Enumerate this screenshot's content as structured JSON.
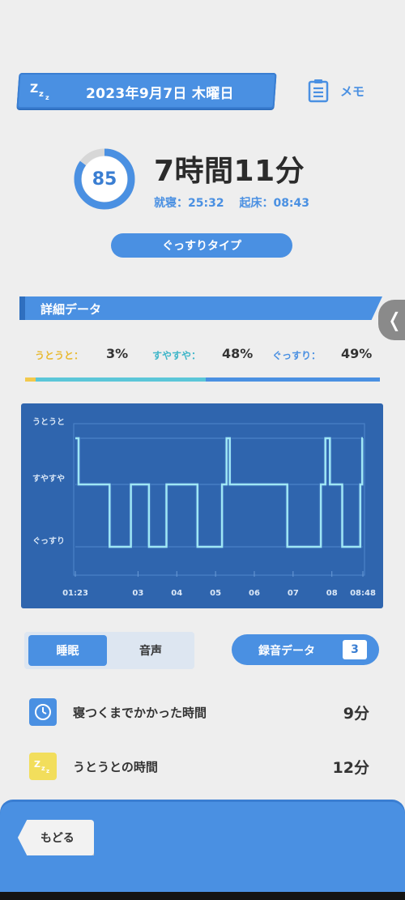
{
  "header": {
    "date": "2023年9月7日 木曜日",
    "memo_label": "メモ"
  },
  "summary": {
    "score": "85",
    "score_fraction": 0.85,
    "duration": "7時間11分",
    "bedtime": "就寝：25:32",
    "waketime": "起床：08:43",
    "type": "ぐっすりタイプ"
  },
  "details": {
    "title": "詳細データ",
    "stats": [
      {
        "label": "うとうと：",
        "value": "3%",
        "color": "#f2c94c",
        "fraction": 0.03
      },
      {
        "label": "すやすや：",
        "value": "48%",
        "color": "#5bc6d8",
        "fraction": 0.48
      },
      {
        "label": "ぐっすり：",
        "value": "49%",
        "color": "#4a90e2",
        "fraction": 0.49
      }
    ]
  },
  "chart_data": {
    "type": "line",
    "y_levels": [
      "うとうと",
      "すやすや",
      "ぐっすり"
    ],
    "x_ticks": [
      "01:23",
      "03",
      "04",
      "05",
      "06",
      "07",
      "08",
      "08:48"
    ],
    "x_tick_minutes": [
      83,
      180,
      240,
      300,
      360,
      420,
      480,
      528
    ],
    "x_range_minutes": [
      83,
      528
    ],
    "series": [
      {
        "steps": [
          [
            83,
            "うとうと"
          ],
          [
            88,
            "すやすや"
          ],
          [
            136,
            "ぐっすり"
          ],
          [
            169,
            "すやすや"
          ],
          [
            197,
            "ぐっすり"
          ],
          [
            224,
            "すやすや"
          ],
          [
            272,
            "ぐっすり"
          ],
          [
            310,
            "すやすや"
          ],
          [
            317,
            "うとうと"
          ],
          [
            322,
            "すやすや"
          ],
          [
            411,
            "ぐっすり"
          ],
          [
            463,
            "すやすや"
          ],
          [
            470,
            "うとうと"
          ],
          [
            477,
            "すやすや"
          ],
          [
            496,
            "ぐっすり"
          ],
          [
            524,
            "すやすや"
          ],
          [
            527,
            "うとうと"
          ],
          [
            528,
            "うとうと"
          ]
        ]
      }
    ]
  },
  "tabs": {
    "sleep": "睡眠",
    "audio": "音声"
  },
  "recording": {
    "label": "録音データ",
    "count": "3"
  },
  "rows": [
    {
      "label": "寝つくまでかかった時間",
      "value": "9分",
      "icon": "clock-icon",
      "icon_color": "#4a90e2"
    },
    {
      "label": "うとうとの時間",
      "value": "12分",
      "icon": "zzz-icon",
      "icon_color": "#f2de5c"
    }
  ],
  "footer": {
    "back_label": "もどる"
  },
  "colors": {
    "accent": "#4a90e2",
    "chart_bg": "#2f65ae",
    "line_light": "#9fe7f5"
  }
}
